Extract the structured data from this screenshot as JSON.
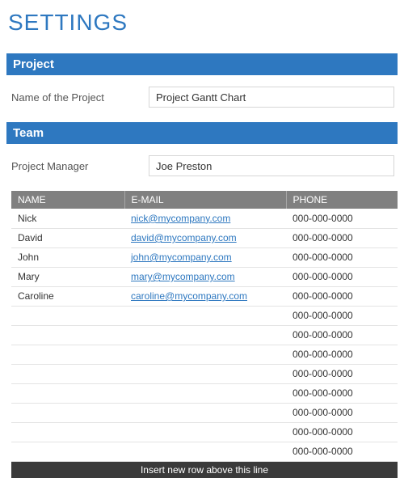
{
  "page_title": "SETTINGS",
  "sections": {
    "project": {
      "header": "Project",
      "field_label": "Name of the Project",
      "field_value": "Project Gantt Chart"
    },
    "team": {
      "header": "Team",
      "manager_label": "Project Manager",
      "manager_value": "Joe Preston",
      "table": {
        "headers": {
          "name": "NAME",
          "email": "E-MAIL",
          "phone": "PHONE"
        },
        "rows": [
          {
            "name": "Nick",
            "email": "nick@mycompany.com",
            "phone": "000-000-0000"
          },
          {
            "name": "David",
            "email": "david@mycompany.com",
            "phone": "000-000-0000"
          },
          {
            "name": "John",
            "email": "john@mycompany.com",
            "phone": "000-000-0000"
          },
          {
            "name": "Mary",
            "email": "mary@mycompany.com",
            "phone": "000-000-0000"
          },
          {
            "name": "Caroline",
            "email": "caroline@mycompany.com",
            "phone": "000-000-0000"
          },
          {
            "name": "",
            "email": "",
            "phone": "000-000-0000"
          },
          {
            "name": "",
            "email": "",
            "phone": "000-000-0000"
          },
          {
            "name": "",
            "email": "",
            "phone": "000-000-0000"
          },
          {
            "name": "",
            "email": "",
            "phone": "000-000-0000"
          },
          {
            "name": "",
            "email": "",
            "phone": "000-000-0000"
          },
          {
            "name": "",
            "email": "",
            "phone": "000-000-0000"
          },
          {
            "name": "",
            "email": "",
            "phone": "000-000-0000"
          },
          {
            "name": "",
            "email": "",
            "phone": "000-000-0000"
          }
        ],
        "footer": "Insert new row above this line"
      }
    }
  }
}
